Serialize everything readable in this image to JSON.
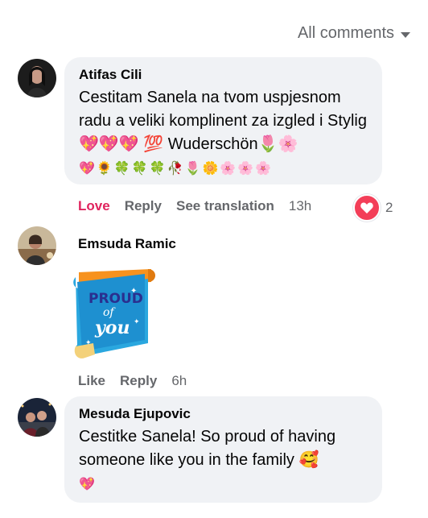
{
  "filter": {
    "label": "All comments"
  },
  "comments": [
    {
      "name": "Atifas Cili",
      "text": "Cestitam Sanela na tvom uspjesnom radu a veliki komplinent za izgled i Stylig💖💖💖 💯 Wuderschön🌷🌸",
      "emoji_line": "💖🌻🍀🍀🍀🥀🌷🌼🌸🌸🌸",
      "actions": {
        "love": "Love",
        "reply": "Reply",
        "translate": "See translation",
        "time": "13h"
      },
      "reaction_count": "2"
    },
    {
      "name": "Emsuda Ramic",
      "sticker_text": [
        "PROUD",
        "of",
        "you"
      ],
      "actions": {
        "like": "Like",
        "reply": "Reply",
        "time": "6h"
      }
    },
    {
      "name": "Mesuda Ejupovic",
      "text": "Cestitke Sanela! So proud of having someone like you in the family 🥰",
      "emoji_line": "💖"
    }
  ],
  "colors": {
    "bubble": "#f0f2f5",
    "secondary_text": "#65676b",
    "love": "#e0245e",
    "heart": "#f33e58"
  }
}
